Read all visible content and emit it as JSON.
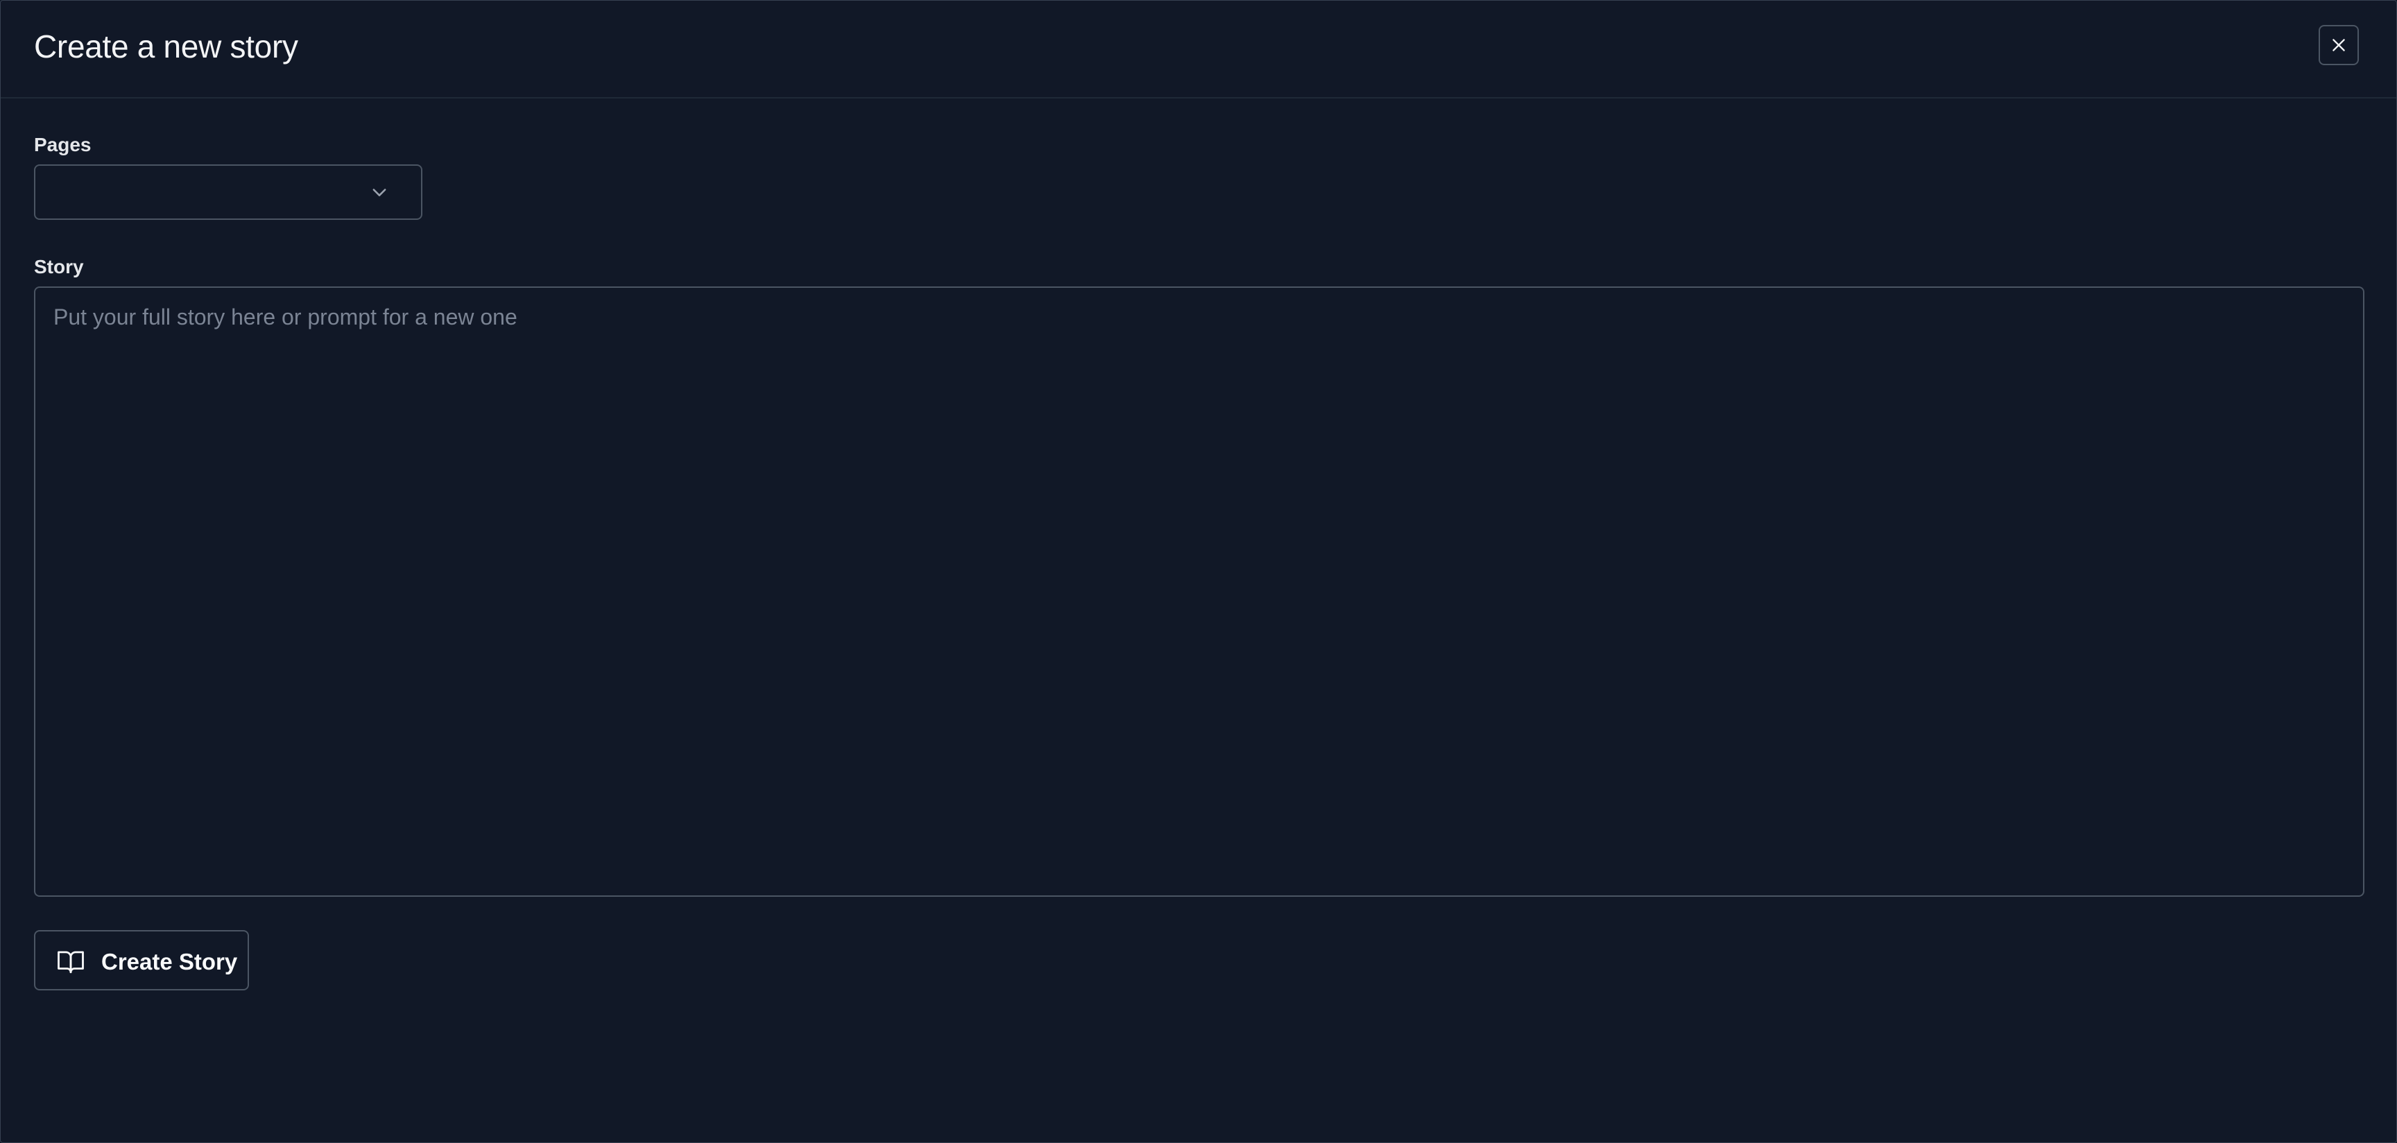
{
  "dialog": {
    "title": "Create a new story"
  },
  "pages": {
    "label": "Pages",
    "value": ""
  },
  "story": {
    "label": "Story",
    "placeholder": "Put your full story here or prompt for a new one",
    "value": ""
  },
  "actions": {
    "create_label": "Create Story"
  },
  "icons": {
    "close": "close-icon",
    "chevron": "chevron-down-icon",
    "book": "book-open-icon"
  },
  "colors": {
    "background": "#111827",
    "border": "#4b5563",
    "text": "#f3f4f6",
    "placeholder": "#7b8494"
  }
}
